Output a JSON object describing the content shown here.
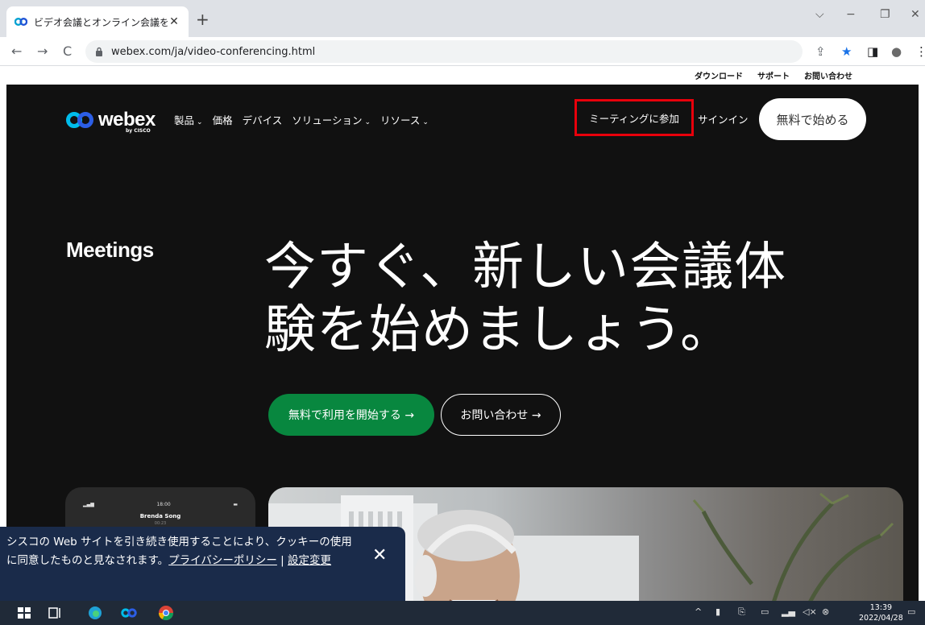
{
  "browser": {
    "tab_title": "ビデオ会議とオンライン会議を無料で",
    "tab_close": "✕",
    "new_tab": "+",
    "url": "webex.com/ja/video-conferencing.html",
    "nav": {
      "back": "←",
      "forward": "→",
      "reload": "C"
    },
    "window": {
      "minimize": "−",
      "restore": "❐",
      "close": "✕",
      "tabsearch": "⌵"
    },
    "toolbar": {
      "share": "⇪",
      "bookmark": "★",
      "sidepanel": "◨",
      "profile": "●",
      "menu": "⋮"
    }
  },
  "utility_nav": [
    "ダウンロード",
    "サポート",
    "お問い合わせ"
  ],
  "header": {
    "logo_word": "webex",
    "logo_by": "by CISCO",
    "nav": [
      {
        "label": "製品",
        "chev": "⌄"
      },
      {
        "label": "価格",
        "chev": ""
      },
      {
        "label": "デバイス",
        "chev": ""
      },
      {
        "label": "ソリューション",
        "chev": "⌄"
      },
      {
        "label": "リソース",
        "chev": "⌄"
      }
    ],
    "join_meeting": "ミーティングに参加",
    "sign_in": "サインイン",
    "start_free": "無料で始める"
  },
  "hero": {
    "label": "Meetings",
    "headline_line1": "今すぐ、新しい会議体",
    "headline_line2": "験を始めましょう。",
    "cta_primary": "無料で利用を開始する →",
    "cta_secondary": "お問い合わせ →"
  },
  "phone": {
    "time": "18:00",
    "caller": "Brenda Song",
    "caller_sub": "00:23"
  },
  "cookie": {
    "message": "シスコの Web サイトを引き続き使用することにより、クッキーの使用に同意したものと見なされます。",
    "privacy_link": "プライバシーポリシー",
    "separator": " | ",
    "settings_link": "設定変更",
    "close": "✕"
  },
  "taskbar": {
    "time": "13:39",
    "date": "2022/04/28"
  },
  "colors": {
    "hero_bg": "#111111",
    "cta_green": "#08873f",
    "highlight_red": "#e8000b",
    "cookie_bg": "#1a2b4a"
  }
}
